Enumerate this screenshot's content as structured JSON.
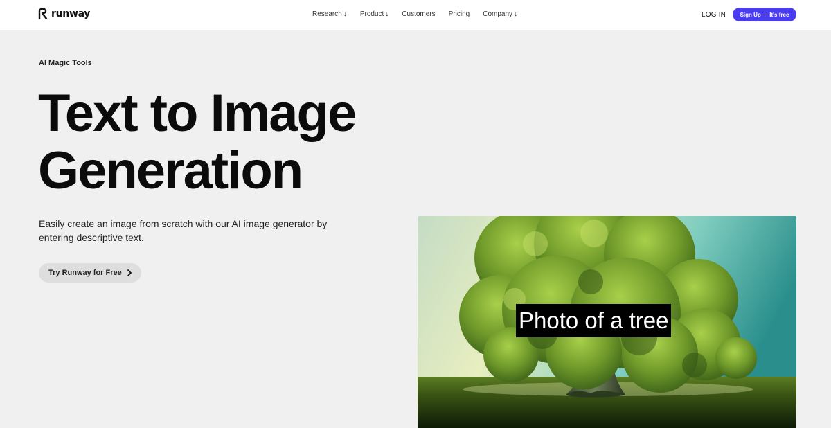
{
  "navbar": {
    "brand": "runway",
    "links": [
      {
        "label": "Research",
        "arrow": "↓"
      },
      {
        "label": "Product",
        "arrow": "↓"
      },
      {
        "label": "Customers",
        "arrow": ""
      },
      {
        "label": "Pricing",
        "arrow": ""
      },
      {
        "label": "Company",
        "arrow": "↓"
      }
    ],
    "login_label": "LOG IN",
    "signup_label": "Sign Up — It's free"
  },
  "hero": {
    "eyebrow": "AI Magic Tools",
    "title_line1": "Text to Image",
    "title_line2": "Generation",
    "description": "Easily create an image from scratch with our AI image generator by entering descriptive text.",
    "cta_label": "Try Runway for Free"
  },
  "image": {
    "caption": "Photo of a tree",
    "subject": "generated-tree-image"
  },
  "colors": {
    "accent": "#4a3df0",
    "background": "#f0f0f0",
    "navbar": "#ffffff",
    "cta_bg": "#dedede"
  },
  "icons": [
    "runway-logo-icon",
    "down-arrow-icon",
    "chevron-right-icon"
  ]
}
